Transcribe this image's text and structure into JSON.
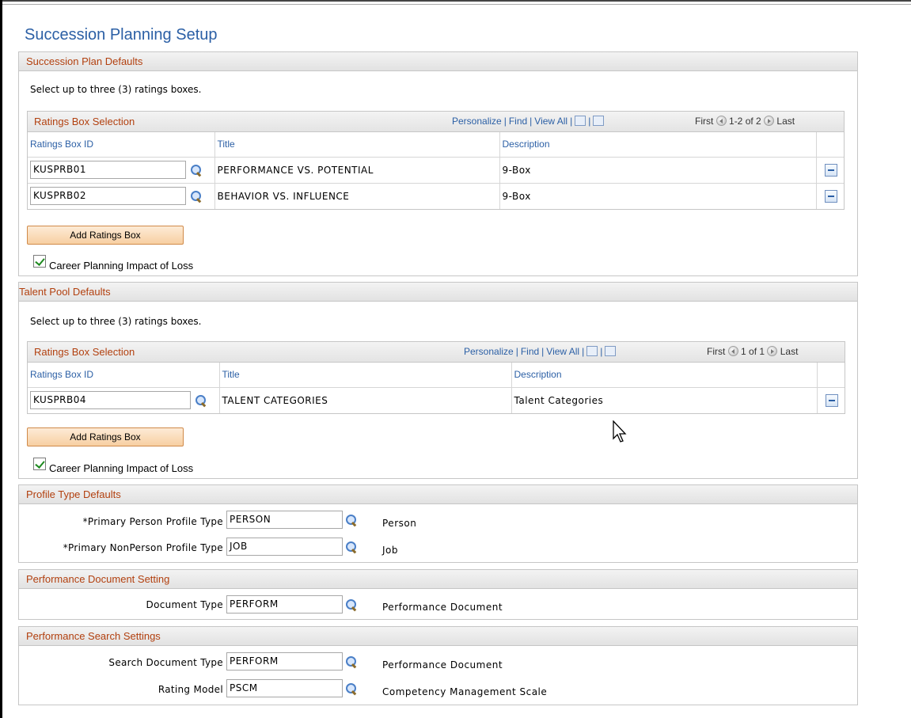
{
  "page": {
    "title": "Succession Planning Setup"
  },
  "succession_plan": {
    "header": "Succession Plan Defaults",
    "note": "Select up to three (3) ratings boxes.",
    "grid": {
      "title": "Ratings Box Selection",
      "nav": {
        "personalize": "Personalize",
        "find": "Find",
        "view_all": "View All"
      },
      "pager": {
        "first": "First",
        "range": "1-2 of 2",
        "last": "Last"
      },
      "columns": [
        "Ratings Box ID",
        "Title",
        "Description"
      ],
      "rows": [
        {
          "id": "KUSPRB01",
          "title": "PERFORMANCE VS. POTENTIAL",
          "desc": "9-Box"
        },
        {
          "id": "KUSPRB02",
          "title": "BEHAVIOR VS. INFLUENCE",
          "desc": "9-Box"
        }
      ]
    },
    "add_button": "Add Ratings Box",
    "checkbox_label": "Career Planning Impact of Loss"
  },
  "talent_pool": {
    "header": "Talent Pool Defaults",
    "note": "Select up to three (3) ratings boxes.",
    "grid": {
      "title": "Ratings Box Selection",
      "nav": {
        "personalize": "Personalize",
        "find": "Find",
        "view_all": "View All"
      },
      "pager": {
        "first": "First",
        "range": "1 of 1",
        "last": "Last"
      },
      "columns": [
        "Ratings Box ID",
        "Title",
        "Description"
      ],
      "rows": [
        {
          "id": "KUSPRB04",
          "title": "TALENT CATEGORIES",
          "desc": "Talent Categories"
        }
      ]
    },
    "add_button": "Add Ratings Box",
    "checkbox_label": "Career Planning Impact of Loss"
  },
  "profile_type": {
    "header": "Profile Type Defaults",
    "primary_person": {
      "label": "*Primary Person Profile Type",
      "value": "PERSON",
      "desc": "Person"
    },
    "primary_nonperson": {
      "label": "*Primary NonPerson Profile Type",
      "value": "JOB",
      "desc": "Job"
    }
  },
  "performance_document": {
    "header": "Performance Document Setting",
    "document_type": {
      "label": "Document Type",
      "value": "PERFORM",
      "desc": "Performance Document"
    }
  },
  "performance_search": {
    "header": "Performance Search Settings",
    "search_document_type": {
      "label": "Search Document Type",
      "value": "PERFORM",
      "desc": "Performance Document"
    },
    "rating_model": {
      "label": "Rating Model",
      "value": "PSCM",
      "desc": "Competency Management Scale"
    }
  }
}
